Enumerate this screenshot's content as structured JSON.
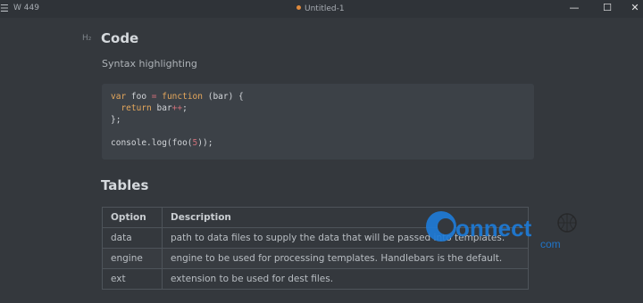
{
  "titlebar": {
    "menu_icon": "hamburger-icon",
    "word_count": "W 449",
    "document_title": "Untitled-1",
    "unsaved_dot_color": "#e08a3c",
    "minimize": "—",
    "maximize": "☐",
    "close": "✕"
  },
  "content": {
    "heading_marker": "H₂",
    "code_heading": "Code",
    "code_paragraph": "Syntax highlighting",
    "tables_heading": "Tables"
  },
  "code_lines": [
    [
      {
        "t": "var ",
        "c": "kw"
      },
      {
        "t": "foo ",
        "c": ""
      },
      {
        "t": "= ",
        "c": "op"
      },
      {
        "t": "function ",
        "c": "kw"
      },
      {
        "t": "(bar) {",
        "c": ""
      }
    ],
    [
      {
        "t": "  ",
        "c": ""
      },
      {
        "t": "return ",
        "c": "kw"
      },
      {
        "t": "bar",
        "c": ""
      },
      {
        "t": "++",
        "c": "op"
      },
      {
        "t": ";",
        "c": ""
      }
    ],
    [
      {
        "t": "};",
        "c": ""
      }
    ],
    [
      {
        "t": "",
        "c": ""
      }
    ],
    [
      {
        "t": "console.log(foo(",
        "c": ""
      },
      {
        "t": "5",
        "c": "num"
      },
      {
        "t": "));",
        "c": ""
      }
    ]
  ],
  "table": {
    "headers": [
      "Option",
      "Description"
    ],
    "rows": [
      [
        "data",
        "path to data files to supply the data that will be passed into templates."
      ],
      [
        "engine",
        "engine to be used for processing templates. Handlebars is the default."
      ],
      [
        "ext",
        "extension to be used for dest files."
      ]
    ]
  },
  "watermark": {
    "text": "connect",
    "suffix": "com",
    "brand_color": "#1e7bd6"
  }
}
